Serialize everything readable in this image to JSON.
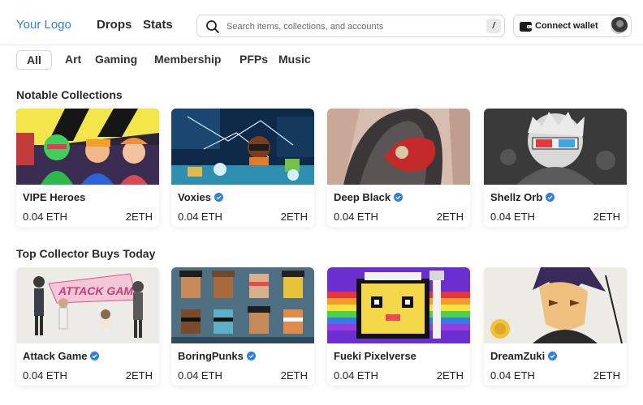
{
  "header": {
    "logo": "Your Logo",
    "nav": [
      "Drops",
      "Stats"
    ],
    "search_placeholder": "Search items, collections, and accounts",
    "search_shortcut": "/",
    "wallet_label": "Connect wallet"
  },
  "categories": [
    "All",
    "Art",
    "Gaming",
    "Membership",
    "PFPs",
    "Music"
  ],
  "active_category": "All",
  "colors": {
    "accent": "#2f7fe0",
    "verified": "#2f7fe0"
  },
  "sections": [
    {
      "title": "Notable Collections",
      "cards": [
        {
          "name": "VIPE Heroes",
          "verified": false,
          "price": "0.04 ETH",
          "volume": "2ETH"
        },
        {
          "name": "Voxies",
          "verified": true,
          "price": "0.04 ETH",
          "volume": "2ETH"
        },
        {
          "name": "Deep Black",
          "verified": true,
          "price": "0.04 ETH",
          "volume": "2ETH"
        },
        {
          "name": "Shellz Orb",
          "verified": true,
          "price": "0.04 ETH",
          "volume": "2ETH"
        }
      ]
    },
    {
      "title": "Top Collector Buys Today",
      "cards": [
        {
          "name": "Attack Game",
          "verified": true,
          "price": "0.04 ETH",
          "volume": "2ETH",
          "image_text": "ATTACK GAME"
        },
        {
          "name": "BoringPunks",
          "verified": true,
          "price": "0.04 ETH",
          "volume": "2ETH"
        },
        {
          "name": "Fueki Pixelverse",
          "verified": false,
          "price": "0.04 ETH",
          "volume": "2ETH"
        },
        {
          "name": "DreamZuki",
          "verified": true,
          "price": "0.04 ETH",
          "volume": "2ETH"
        }
      ]
    }
  ]
}
